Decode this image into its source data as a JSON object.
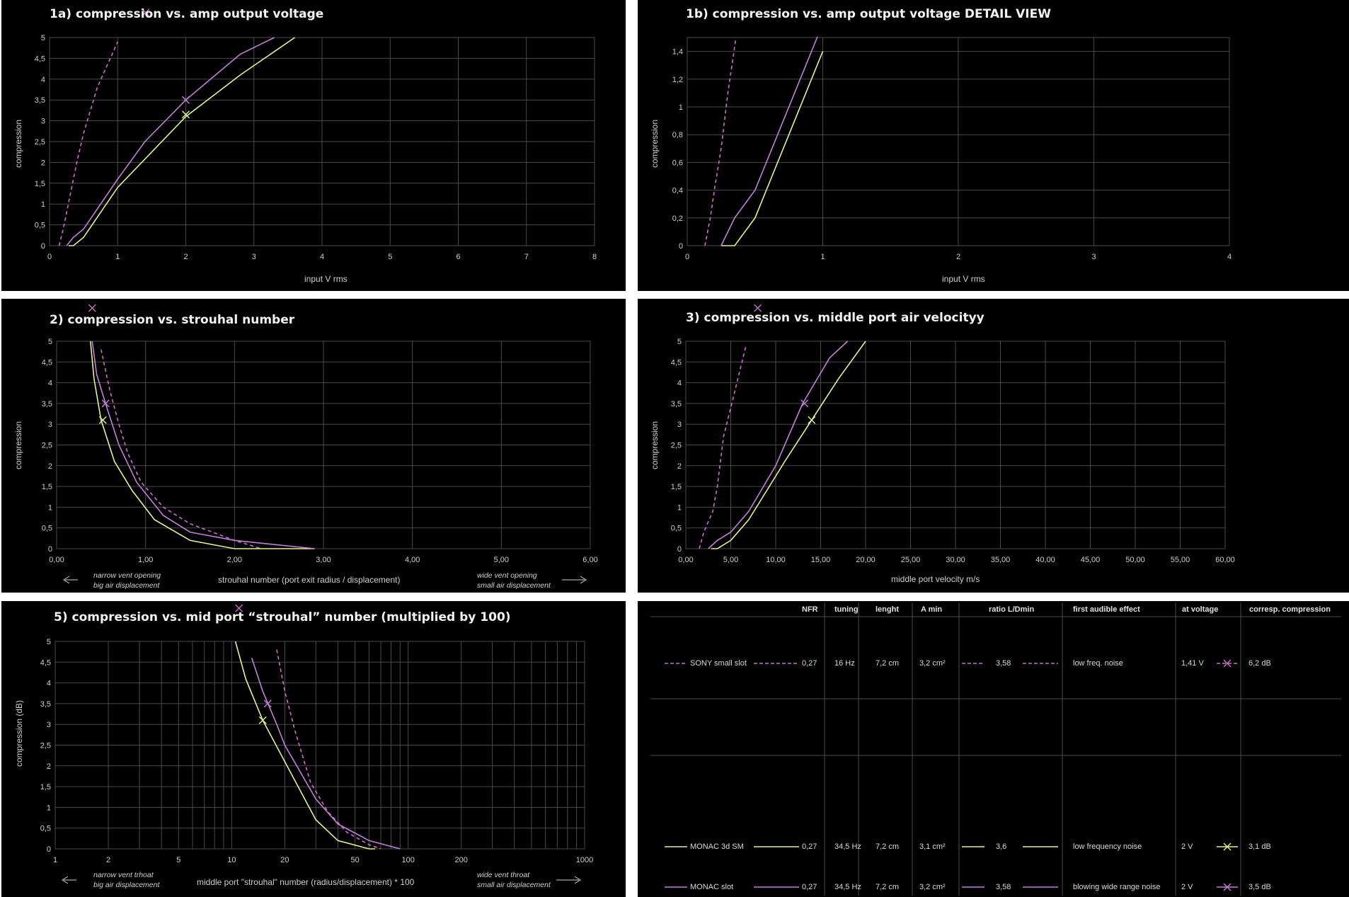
{
  "colors": {
    "sony": "#cc6ccb",
    "monac_sm": "#e6f28a",
    "monac_slot": "#c57ed9",
    "grid": "#4a4a4a",
    "text": "#cfcfcf"
  },
  "chart_data": [
    {
      "id": "c1a",
      "type": "line",
      "title": "1a) compression vs. amp output voltage",
      "xlabel": "input V rms",
      "ylabel": "compression",
      "xlim": [
        0,
        8
      ],
      "ylim": [
        0,
        5
      ],
      "xticks": [
        "0",
        "1",
        "2",
        "3",
        "4",
        "5",
        "6",
        "7",
        "8"
      ],
      "yticks": [
        "0",
        "0,5",
        "1",
        "1,5",
        "2",
        "2,5",
        "3",
        "3,5",
        "4",
        "4,5",
        "5"
      ],
      "series": [
        {
          "name": "SONY small slot",
          "style": "dashed",
          "color": "sony",
          "x": [
            0.14,
            0.2,
            0.3,
            0.4,
            0.5,
            0.7,
            1.0
          ],
          "y": [
            0,
            0.4,
            1.2,
            2.0,
            2.7,
            3.8,
            4.9
          ]
        },
        {
          "name": "MONAC 3d SM",
          "style": "solid",
          "color": "monac_sm",
          "x": [
            0.28,
            0.35,
            0.5,
            1.0,
            2.0,
            2.8,
            3.6
          ],
          "y": [
            0,
            0,
            0.2,
            1.4,
            3.1,
            4.1,
            5.0
          ]
        },
        {
          "name": "MONAC slot",
          "style": "solid",
          "color": "monac_slot",
          "x": [
            0.25,
            0.35,
            0.5,
            1.0,
            1.4,
            2.0,
            2.8,
            3.3
          ],
          "y": [
            0,
            0.2,
            0.4,
            1.6,
            2.5,
            3.5,
            4.6,
            5.0
          ]
        }
      ],
      "markers": [
        {
          "color": "monac_slot",
          "x": 2.0,
          "y": 3.5
        },
        {
          "color": "monac_sm",
          "x": 2.0,
          "y": 3.15
        },
        {
          "color": "sony",
          "x": 1.41,
          "y": 5.6
        }
      ]
    },
    {
      "id": "c1b",
      "type": "line",
      "title": "1b) compression vs. amp output voltage DETAIL VIEW",
      "xlabel": "input V rms",
      "ylabel": "compression",
      "xlim": [
        0,
        4
      ],
      "ylim": [
        0,
        1.5
      ],
      "xticks": [
        "0",
        "1",
        "2",
        "3",
        "4"
      ],
      "yticks": [
        "0",
        "0,2",
        "0,4",
        "0,6",
        "0,8",
        "1",
        "1,2",
        "1,4"
      ],
      "series": [
        {
          "name": "SONY small slot",
          "style": "dashed",
          "color": "sony",
          "x": [
            0.13,
            0.17,
            0.2,
            0.25,
            0.3,
            0.36
          ],
          "y": [
            0,
            0.2,
            0.4,
            0.7,
            1.1,
            1.5
          ]
        },
        {
          "name": "MONAC 3d SM",
          "style": "solid",
          "color": "monac_sm",
          "x": [
            0.25,
            0.35,
            0.5,
            1.0
          ],
          "y": [
            0,
            0,
            0.2,
            1.4
          ]
        },
        {
          "name": "MONAC slot",
          "style": "solid",
          "color": "monac_slot",
          "x": [
            0.25,
            0.35,
            0.5,
            1.0
          ],
          "y": [
            0,
            0.2,
            0.4,
            1.6
          ]
        }
      ],
      "markers": []
    },
    {
      "id": "c2",
      "type": "line",
      "title": "2) compression vs. strouhal number",
      "xlabel": "strouhal number (port exit radius / displacement)",
      "ylabel": "compression",
      "xlim": [
        0,
        6
      ],
      "ylim": [
        0,
        5
      ],
      "xticks": [
        "0,00",
        "1,00",
        "2,00",
        "3,00",
        "4,00",
        "5,00",
        "6,00"
      ],
      "yticks": [
        "0",
        "0,5",
        "1",
        "1,5",
        "2",
        "2,5",
        "3",
        "3,5",
        "4",
        "4,5",
        "5"
      ],
      "notes": {
        "left": [
          "narrow vent opening",
          "big air displacement"
        ],
        "right": [
          "wide vent opening",
          "small air displacement"
        ]
      },
      "series": [
        {
          "name": "SONY small slot",
          "style": "dashed",
          "color": "sony",
          "x": [
            0.5,
            0.6,
            0.7,
            0.8,
            0.95,
            1.2,
            1.5,
            2.0,
            2.3
          ],
          "y": [
            4.8,
            3.8,
            3.0,
            2.3,
            1.6,
            1.0,
            0.6,
            0.2,
            0
          ]
        },
        {
          "name": "MONAC 3d SM",
          "style": "solid",
          "color": "monac_sm",
          "x": [
            0.38,
            0.42,
            0.5,
            0.65,
            0.85,
            1.1,
            1.5,
            2.0,
            2.9
          ],
          "y": [
            5.0,
            4.1,
            3.1,
            2.1,
            1.4,
            0.7,
            0.2,
            0,
            0
          ]
        },
        {
          "name": "MONAC slot",
          "style": "solid",
          "color": "monac_slot",
          "x": [
            0.4,
            0.45,
            0.55,
            0.7,
            0.9,
            1.2,
            1.5,
            2.0,
            2.9
          ],
          "y": [
            5.0,
            4.2,
            3.5,
            2.5,
            1.6,
            0.8,
            0.4,
            0.2,
            0
          ]
        }
      ],
      "markers": [
        {
          "color": "monac_slot",
          "x": 0.55,
          "y": 3.5
        },
        {
          "color": "monac_sm",
          "x": 0.52,
          "y": 3.1
        },
        {
          "color": "sony",
          "x": 0.4,
          "y": 5.8
        }
      ]
    },
    {
      "id": "c3",
      "type": "line",
      "title": "3) compression vs. middle port air velocityy",
      "xlabel": "middle port velocity m/s",
      "ylabel": "compression",
      "xlim": [
        0,
        60
      ],
      "ylim": [
        0,
        5
      ],
      "xticks": [
        "0,00",
        "5,00",
        "10,00",
        "15,00",
        "20,00",
        "25,00",
        "30,00",
        "35,00",
        "40,00",
        "45,00",
        "50,00",
        "55,00",
        "60,00"
      ],
      "yticks": [
        "0",
        "0,5",
        "1",
        "1,5",
        "2",
        "2,5",
        "3",
        "3,5",
        "4",
        "4,5",
        "5"
      ],
      "series": [
        {
          "name": "SONY small slot",
          "style": "dashed",
          "color": "sony",
          "x": [
            1.5,
            2.0,
            3.0,
            3.5,
            4.2,
            5.0,
            6.7
          ],
          "y": [
            0,
            0.4,
            0.9,
            1.5,
            2.7,
            3.4,
            4.9
          ]
        },
        {
          "name": "MONAC 3d SM",
          "style": "solid",
          "color": "monac_sm",
          "x": [
            2.8,
            3.5,
            5.0,
            7.0,
            9.0,
            11.0,
            14.0,
            17.0,
            20.0
          ],
          "y": [
            0,
            0,
            0.2,
            0.7,
            1.4,
            2.1,
            3.1,
            4.1,
            5.0
          ]
        },
        {
          "name": "MONAC slot",
          "style": "solid",
          "color": "monac_slot",
          "x": [
            2.5,
            3.5,
            5.0,
            7.0,
            10.0,
            13.0,
            16.0,
            18.0
          ],
          "y": [
            0,
            0.2,
            0.4,
            0.9,
            2.0,
            3.5,
            4.6,
            5.0
          ]
        }
      ],
      "markers": [
        {
          "color": "monac_slot",
          "x": 13.2,
          "y": 3.5
        },
        {
          "color": "monac_sm",
          "x": 14.0,
          "y": 3.1
        },
        {
          "color": "sony",
          "x": 8.0,
          "y": 5.8
        }
      ]
    },
    {
      "id": "c5",
      "type": "line",
      "title": "5) compression vs. mid port “strouhal” number (multiplied by 100)",
      "xlabel": "middle port \"strouhal\" number (radius/displacement) * 100",
      "ylabel": "compression (dB)",
      "xscale": "log",
      "xlim": [
        1,
        1000
      ],
      "ylim": [
        0,
        5
      ],
      "xticks": [
        "1",
        "2",
        "5",
        "10",
        "20",
        "50",
        "100",
        "200",
        "1000"
      ],
      "xtick_values": [
        1,
        2,
        5,
        10,
        20,
        50,
        100,
        200,
        1000
      ],
      "yticks": [
        "0",
        "0,5",
        "1",
        "1,5",
        "2",
        "2,5",
        "3",
        "3,5",
        "4",
        "4,5",
        "5"
      ],
      "notes": {
        "left": [
          "narrow vent trhoat",
          "big air displacement"
        ],
        "right": [
          "wide vent throat",
          "small air displacement"
        ]
      },
      "series": [
        {
          "name": "SONY small slot",
          "style": "dashed",
          "color": "sony",
          "x": [
            18,
            20,
            23,
            28,
            35,
            45,
            60,
            70
          ],
          "y": [
            4.8,
            3.8,
            2.8,
            1.6,
            0.9,
            0.4,
            0.1,
            0
          ]
        },
        {
          "name": "MONAC 3d SM",
          "style": "solid",
          "color": "monac_sm",
          "x": [
            10.5,
            12,
            15,
            20,
            30,
            40,
            60,
            65
          ],
          "y": [
            5.0,
            4.1,
            3.1,
            2.1,
            0.7,
            0.2,
            0,
            0
          ]
        },
        {
          "name": "MONAC slot",
          "style": "solid",
          "color": "monac_slot",
          "x": [
            13,
            15,
            18,
            20,
            30,
            40,
            60,
            90
          ],
          "y": [
            4.6,
            3.8,
            3.0,
            2.5,
            1.2,
            0.6,
            0.2,
            0
          ]
        }
      ],
      "markers": [
        {
          "color": "monac_slot",
          "x": 16,
          "y": 3.5
        },
        {
          "color": "monac_sm",
          "x": 15,
          "y": 3.1
        },
        {
          "color": "sony",
          "x": 11,
          "y": 5.8
        }
      ]
    }
  ],
  "legend_table": {
    "headers": [
      "NFR",
      "tuning",
      "lenght",
      "A min",
      "ratio L/Dmin",
      "first audible effect",
      "at voltage",
      "corresp. compression"
    ],
    "rows": [
      {
        "name": "SONY small slot",
        "style": "dashed",
        "color": "sony",
        "nfr": "0,27",
        "tuning": "16 Hz",
        "length": "7,2 cm",
        "amin": "3,2 cm²",
        "ratio": "3,58",
        "effect": "low freq. noise",
        "voltage": "1,41 V",
        "compression": "6,2 dB"
      },
      {
        "name": "MONAC 3d SM",
        "style": "solid",
        "color": "monac_sm",
        "nfr": "0,27",
        "tuning": "34,5 Hz",
        "length": "7,2 cm",
        "amin": "3,1 cm²",
        "ratio": "3,6",
        "effect": "low frequency noise",
        "voltage": "2 V",
        "compression": "3,1 dB"
      },
      {
        "name": "MONAC slot",
        "style": "solid",
        "color": "monac_slot",
        "nfr": "0,27",
        "tuning": "34,5 Hz",
        "length": "7,2 cm",
        "amin": "3,2 cm²",
        "ratio": "3,58",
        "effect": "blowing wide range noise",
        "voltage": "2 V",
        "compression": "3,5 dB"
      }
    ]
  }
}
